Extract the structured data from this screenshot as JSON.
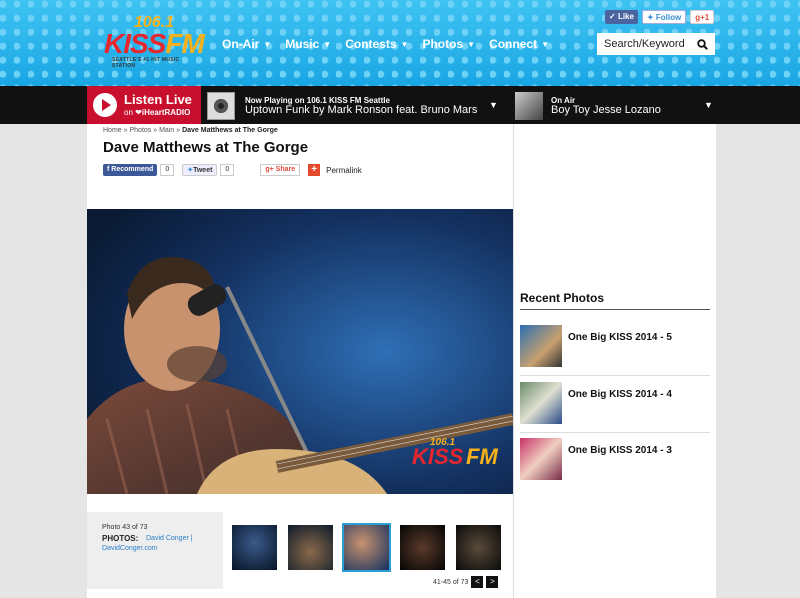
{
  "header": {
    "logo_number": "106.1",
    "logo_kiss": "KISS",
    "logo_fm": "FM",
    "logo_tagline": "SEATTLE'S #1 HIT MUSIC STATION",
    "nav": [
      "On-Air",
      "Music",
      "Contests",
      "Photos",
      "Connect"
    ],
    "social": {
      "like": "Like",
      "follow": "Follow",
      "gplus": "g+1"
    },
    "search_placeholder": "Search/Keyword"
  },
  "player": {
    "listen_live": "Listen Live",
    "on_label": "on",
    "iheart": "iHeartRADIO",
    "now_playing_label": "Now Playing on 106.1 KISS FM Seattle",
    "now_playing_song": "Uptown Funk by Mark Ronson feat. Bruno Mars",
    "on_air_label": "On Air",
    "on_air_host": "Boy Toy Jesse Lozano"
  },
  "breadcrumb": {
    "items": [
      "Home",
      "Photos",
      "Main"
    ],
    "current": "Dave Matthews at The Gorge"
  },
  "page_title": "Dave Matthews at The Gorge",
  "share": {
    "recommend": "Recommend",
    "recommend_count": "0",
    "tweet": "Tweet",
    "tweet_count": "0",
    "share": "Share",
    "permalink": "Permalink"
  },
  "gallery": {
    "photo_count": "Photo 43 of 73",
    "photos_label": "PHOTOS:",
    "photos_credit": "David Conger | DavidConger.com",
    "range": "41-45 of 73",
    "prev": "<",
    "next": ">"
  },
  "sidebar": {
    "recent_title": "Recent Photos",
    "items": [
      {
        "label": "One Big KISS 2014 - 5"
      },
      {
        "label": "One Big KISS 2014 - 4"
      },
      {
        "label": "One Big KISS 2014 - 3"
      }
    ]
  },
  "colors": {
    "brand_red": "#c8102e",
    "sky": "#1aa6e4",
    "link": "#2a7ec8"
  }
}
